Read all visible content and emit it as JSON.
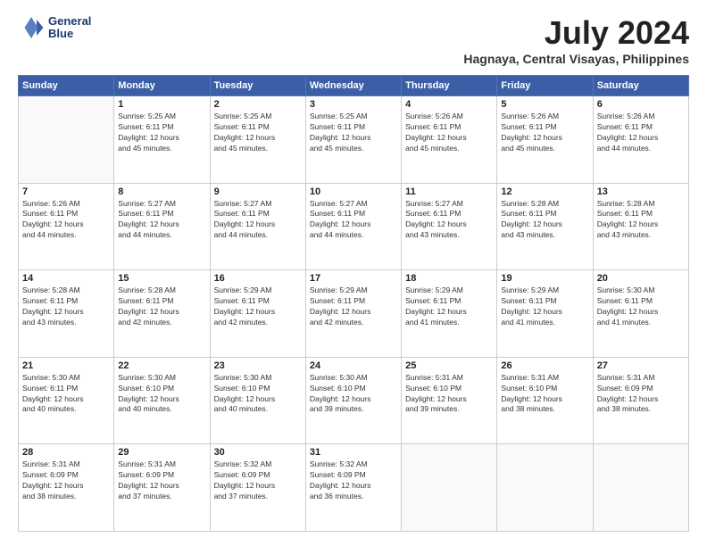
{
  "header": {
    "logo_line1": "General",
    "logo_line2": "Blue",
    "month": "July 2024",
    "location": "Hagnaya, Central Visayas, Philippines"
  },
  "weekdays": [
    "Sunday",
    "Monday",
    "Tuesday",
    "Wednesday",
    "Thursday",
    "Friday",
    "Saturday"
  ],
  "weeks": [
    [
      {
        "day": "",
        "info": ""
      },
      {
        "day": "1",
        "info": "Sunrise: 5:25 AM\nSunset: 6:11 PM\nDaylight: 12 hours\nand 45 minutes."
      },
      {
        "day": "2",
        "info": "Sunrise: 5:25 AM\nSunset: 6:11 PM\nDaylight: 12 hours\nand 45 minutes."
      },
      {
        "day": "3",
        "info": "Sunrise: 5:25 AM\nSunset: 6:11 PM\nDaylight: 12 hours\nand 45 minutes."
      },
      {
        "day": "4",
        "info": "Sunrise: 5:26 AM\nSunset: 6:11 PM\nDaylight: 12 hours\nand 45 minutes."
      },
      {
        "day": "5",
        "info": "Sunrise: 5:26 AM\nSunset: 6:11 PM\nDaylight: 12 hours\nand 45 minutes."
      },
      {
        "day": "6",
        "info": "Sunrise: 5:26 AM\nSunset: 6:11 PM\nDaylight: 12 hours\nand 44 minutes."
      }
    ],
    [
      {
        "day": "7",
        "info": "Sunrise: 5:26 AM\nSunset: 6:11 PM\nDaylight: 12 hours\nand 44 minutes."
      },
      {
        "day": "8",
        "info": "Sunrise: 5:27 AM\nSunset: 6:11 PM\nDaylight: 12 hours\nand 44 minutes."
      },
      {
        "day": "9",
        "info": "Sunrise: 5:27 AM\nSunset: 6:11 PM\nDaylight: 12 hours\nand 44 minutes."
      },
      {
        "day": "10",
        "info": "Sunrise: 5:27 AM\nSunset: 6:11 PM\nDaylight: 12 hours\nand 44 minutes."
      },
      {
        "day": "11",
        "info": "Sunrise: 5:27 AM\nSunset: 6:11 PM\nDaylight: 12 hours\nand 43 minutes."
      },
      {
        "day": "12",
        "info": "Sunrise: 5:28 AM\nSunset: 6:11 PM\nDaylight: 12 hours\nand 43 minutes."
      },
      {
        "day": "13",
        "info": "Sunrise: 5:28 AM\nSunset: 6:11 PM\nDaylight: 12 hours\nand 43 minutes."
      }
    ],
    [
      {
        "day": "14",
        "info": "Sunrise: 5:28 AM\nSunset: 6:11 PM\nDaylight: 12 hours\nand 43 minutes."
      },
      {
        "day": "15",
        "info": "Sunrise: 5:28 AM\nSunset: 6:11 PM\nDaylight: 12 hours\nand 42 minutes."
      },
      {
        "day": "16",
        "info": "Sunrise: 5:29 AM\nSunset: 6:11 PM\nDaylight: 12 hours\nand 42 minutes."
      },
      {
        "day": "17",
        "info": "Sunrise: 5:29 AM\nSunset: 6:11 PM\nDaylight: 12 hours\nand 42 minutes."
      },
      {
        "day": "18",
        "info": "Sunrise: 5:29 AM\nSunset: 6:11 PM\nDaylight: 12 hours\nand 41 minutes."
      },
      {
        "day": "19",
        "info": "Sunrise: 5:29 AM\nSunset: 6:11 PM\nDaylight: 12 hours\nand 41 minutes."
      },
      {
        "day": "20",
        "info": "Sunrise: 5:30 AM\nSunset: 6:11 PM\nDaylight: 12 hours\nand 41 minutes."
      }
    ],
    [
      {
        "day": "21",
        "info": "Sunrise: 5:30 AM\nSunset: 6:11 PM\nDaylight: 12 hours\nand 40 minutes."
      },
      {
        "day": "22",
        "info": "Sunrise: 5:30 AM\nSunset: 6:10 PM\nDaylight: 12 hours\nand 40 minutes."
      },
      {
        "day": "23",
        "info": "Sunrise: 5:30 AM\nSunset: 6:10 PM\nDaylight: 12 hours\nand 40 minutes."
      },
      {
        "day": "24",
        "info": "Sunrise: 5:30 AM\nSunset: 6:10 PM\nDaylight: 12 hours\nand 39 minutes."
      },
      {
        "day": "25",
        "info": "Sunrise: 5:31 AM\nSunset: 6:10 PM\nDaylight: 12 hours\nand 39 minutes."
      },
      {
        "day": "26",
        "info": "Sunrise: 5:31 AM\nSunset: 6:10 PM\nDaylight: 12 hours\nand 38 minutes."
      },
      {
        "day": "27",
        "info": "Sunrise: 5:31 AM\nSunset: 6:09 PM\nDaylight: 12 hours\nand 38 minutes."
      }
    ],
    [
      {
        "day": "28",
        "info": "Sunrise: 5:31 AM\nSunset: 6:09 PM\nDaylight: 12 hours\nand 38 minutes."
      },
      {
        "day": "29",
        "info": "Sunrise: 5:31 AM\nSunset: 6:09 PM\nDaylight: 12 hours\nand 37 minutes."
      },
      {
        "day": "30",
        "info": "Sunrise: 5:32 AM\nSunset: 6:09 PM\nDaylight: 12 hours\nand 37 minutes."
      },
      {
        "day": "31",
        "info": "Sunrise: 5:32 AM\nSunset: 6:09 PM\nDaylight: 12 hours\nand 36 minutes."
      },
      {
        "day": "",
        "info": ""
      },
      {
        "day": "",
        "info": ""
      },
      {
        "day": "",
        "info": ""
      }
    ]
  ]
}
